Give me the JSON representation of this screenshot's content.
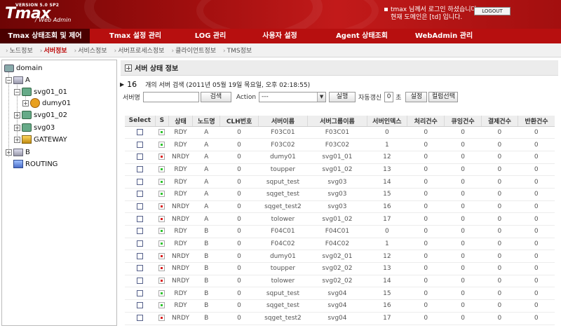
{
  "header": {
    "logo_version": "VERSION 5.0 SP2",
    "logo_main": "Tmax",
    "logo_sub": "/ Web Admin",
    "login_line1": "tmax 님께서 로그인 하셨습니다.",
    "login_line2": "현재 도메인은 [td] 입니다.",
    "logout_label": "LOGOUT"
  },
  "mainnav": [
    {
      "label": "Tmax 상태조회 및 제어",
      "active": true
    },
    {
      "label": "Tmax 설정 관리",
      "active": false
    },
    {
      "label": "LOG 관리",
      "active": false
    },
    {
      "label": "사용자 설정",
      "active": false
    },
    {
      "label": "Agent 상태조회",
      "active": false
    },
    {
      "label": "WebAdmin 관리",
      "active": false
    }
  ],
  "subnav": [
    {
      "label": "노드정보",
      "active": false
    },
    {
      "label": "서버정보",
      "active": true
    },
    {
      "label": "서비스정보",
      "active": false
    },
    {
      "label": "서버프로세스정보",
      "active": false
    },
    {
      "label": "클라이언트정보",
      "active": false
    },
    {
      "label": "TMS정보",
      "active": false
    }
  ],
  "tree": {
    "domain": "domain",
    "node_a": "A",
    "svg01_01": "svg01_01",
    "dumy01": "dumy01",
    "svg01_02": "svg01_02",
    "svg03": "svg03",
    "gateway": "GATEWAY",
    "node_b": "B",
    "routing": "ROUTING"
  },
  "content": {
    "title": "서버 상태 정보",
    "count": "16",
    "count_text": "개의 서버 검색 (2011년 05월 19일 목요일, 오후 02:18:55)",
    "server_name_label": "서버명",
    "search_button": "검색",
    "action_label": "Action",
    "action_value": "---",
    "execute_button": "실행",
    "auto_refresh_label": "자동갱신",
    "auto_refresh_value": "0",
    "seconds_label": "초",
    "settings_button": "설정",
    "column_select_button": "컬럼선택"
  },
  "table": {
    "headers": [
      "Select",
      "S",
      "상태",
      "노드명",
      "CLH번호",
      "서버이름",
      "서버그룹이름",
      "서버인덱스",
      "처리건수",
      "큐잉건수",
      "결제건수",
      "반환건수"
    ],
    "rows": [
      {
        "s": "green",
        "state": "RDY",
        "node": "A",
        "clh": "0",
        "name": "F03C01",
        "group": "F03C01",
        "idx": "0",
        "proc": "0",
        "queue": "0",
        "pay": "0",
        "ret": "0"
      },
      {
        "s": "green",
        "state": "RDY",
        "node": "A",
        "clh": "0",
        "name": "F03C02",
        "group": "F03C02",
        "idx": "1",
        "proc": "0",
        "queue": "0",
        "pay": "0",
        "ret": "0"
      },
      {
        "s": "red",
        "state": "NRDY",
        "node": "A",
        "clh": "0",
        "name": "dumy01",
        "group": "svg01_01",
        "idx": "12",
        "proc": "0",
        "queue": "0",
        "pay": "0",
        "ret": "0"
      },
      {
        "s": "green",
        "state": "RDY",
        "node": "A",
        "clh": "0",
        "name": "toupper",
        "group": "svg01_02",
        "idx": "13",
        "proc": "0",
        "queue": "0",
        "pay": "0",
        "ret": "0"
      },
      {
        "s": "green",
        "state": "RDY",
        "node": "A",
        "clh": "0",
        "name": "sqput_test",
        "group": "svg03",
        "idx": "14",
        "proc": "0",
        "queue": "0",
        "pay": "0",
        "ret": "0"
      },
      {
        "s": "green",
        "state": "RDY",
        "node": "A",
        "clh": "0",
        "name": "sqget_test",
        "group": "svg03",
        "idx": "15",
        "proc": "0",
        "queue": "0",
        "pay": "0",
        "ret": "0"
      },
      {
        "s": "red",
        "state": "NRDY",
        "node": "A",
        "clh": "0",
        "name": "sqget_test2",
        "group": "svg03",
        "idx": "16",
        "proc": "0",
        "queue": "0",
        "pay": "0",
        "ret": "0"
      },
      {
        "s": "red",
        "state": "NRDY",
        "node": "A",
        "clh": "0",
        "name": "tolower",
        "group": "svg01_02",
        "idx": "17",
        "proc": "0",
        "queue": "0",
        "pay": "0",
        "ret": "0"
      },
      {
        "s": "green",
        "state": "RDY",
        "node": "B",
        "clh": "0",
        "name": "F04C01",
        "group": "F04C01",
        "idx": "0",
        "proc": "0",
        "queue": "0",
        "pay": "0",
        "ret": "0"
      },
      {
        "s": "green",
        "state": "RDY",
        "node": "B",
        "clh": "0",
        "name": "F04C02",
        "group": "F04C02",
        "idx": "1",
        "proc": "0",
        "queue": "0",
        "pay": "0",
        "ret": "0"
      },
      {
        "s": "red",
        "state": "NRDY",
        "node": "B",
        "clh": "0",
        "name": "dumy01",
        "group": "svg02_01",
        "idx": "12",
        "proc": "0",
        "queue": "0",
        "pay": "0",
        "ret": "0"
      },
      {
        "s": "red",
        "state": "NRDY",
        "node": "B",
        "clh": "0",
        "name": "toupper",
        "group": "svg02_02",
        "idx": "13",
        "proc": "0",
        "queue": "0",
        "pay": "0",
        "ret": "0"
      },
      {
        "s": "red",
        "state": "NRDY",
        "node": "B",
        "clh": "0",
        "name": "tolower",
        "group": "svg02_02",
        "idx": "14",
        "proc": "0",
        "queue": "0",
        "pay": "0",
        "ret": "0"
      },
      {
        "s": "green",
        "state": "RDY",
        "node": "B",
        "clh": "0",
        "name": "sqput_test",
        "group": "svg04",
        "idx": "15",
        "proc": "0",
        "queue": "0",
        "pay": "0",
        "ret": "0"
      },
      {
        "s": "green",
        "state": "RDY",
        "node": "B",
        "clh": "0",
        "name": "sqget_test",
        "group": "svg04",
        "idx": "16",
        "proc": "0",
        "queue": "0",
        "pay": "0",
        "ret": "0"
      },
      {
        "s": "red",
        "state": "NRDY",
        "node": "B",
        "clh": "0",
        "name": "sqget_test2",
        "group": "svg04",
        "idx": "17",
        "proc": "0",
        "queue": "0",
        "pay": "0",
        "ret": "0"
      }
    ]
  },
  "colors": {
    "brand_red": "#b70f0f",
    "nav_active": "#4a0000",
    "status_ready": "#2ec32e",
    "status_not_ready": "#d92020"
  }
}
